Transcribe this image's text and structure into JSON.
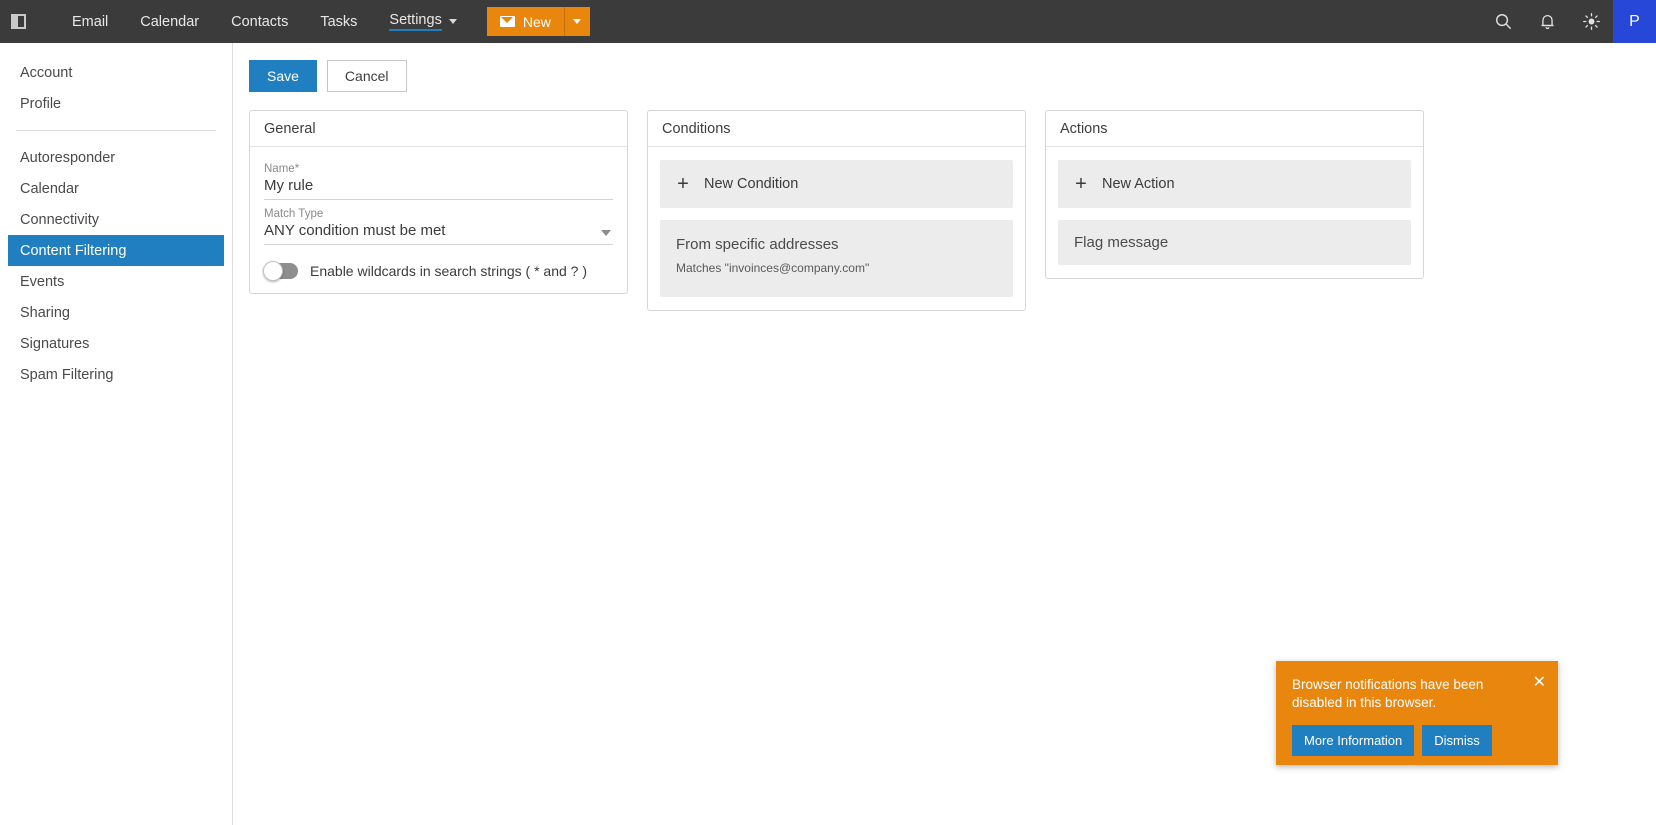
{
  "topbar": {
    "panel_toggle_icon": "sidebar-panel-icon",
    "nav": [
      {
        "label": "Email",
        "active": false,
        "has_caret": false
      },
      {
        "label": "Calendar",
        "active": false,
        "has_caret": false
      },
      {
        "label": "Contacts",
        "active": false,
        "has_caret": false
      },
      {
        "label": "Tasks",
        "active": false,
        "has_caret": false
      },
      {
        "label": "Settings",
        "active": true,
        "has_caret": true
      }
    ],
    "new_button": {
      "label": "New",
      "icon": "envelope-icon",
      "dropdown_icon": "chevron-down-icon",
      "color": "#e8860e"
    },
    "right_icons": [
      {
        "name": "search-icon"
      },
      {
        "name": "bell-icon"
      },
      {
        "name": "brightness-icon"
      }
    ],
    "avatar": {
      "initial": "P",
      "color": "#2747d8"
    }
  },
  "sidebar": {
    "group_one": [
      {
        "label": "Account"
      },
      {
        "label": "Profile"
      }
    ],
    "group_two": [
      {
        "label": "Autoresponder"
      },
      {
        "label": "Calendar"
      },
      {
        "label": "Connectivity"
      },
      {
        "label": "Content Filtering"
      },
      {
        "label": "Events"
      },
      {
        "label": "Sharing"
      },
      {
        "label": "Signatures"
      },
      {
        "label": "Spam Filtering"
      }
    ],
    "selected": "Content Filtering",
    "selected_color": "#1f7fc0"
  },
  "toolbar": {
    "save_label": "Save",
    "cancel_label": "Cancel"
  },
  "general": {
    "header": "General",
    "name_label": "Name",
    "name_required": "*",
    "name_value": "My rule",
    "match_type_label": "Match Type",
    "match_type_value": "ANY condition must be met",
    "wildcard_label": "Enable wildcards in search strings ( * and ? )",
    "wildcard_enabled": false
  },
  "conditions": {
    "header": "Conditions",
    "new_label": "New Condition",
    "items": [
      {
        "title": "From specific addresses",
        "subtitle": "Matches \"invoinces@company.com\""
      }
    ]
  },
  "actions": {
    "header": "Actions",
    "new_label": "New Action",
    "items": [
      {
        "title": "Flag message"
      }
    ]
  },
  "toast": {
    "message": "Browser notifications have been disabled in this browser.",
    "close_icon": "close-icon",
    "more_info_label": "More Information",
    "dismiss_label": "Dismiss",
    "background": "#e8860e",
    "button_color": "#1f7fc0"
  }
}
